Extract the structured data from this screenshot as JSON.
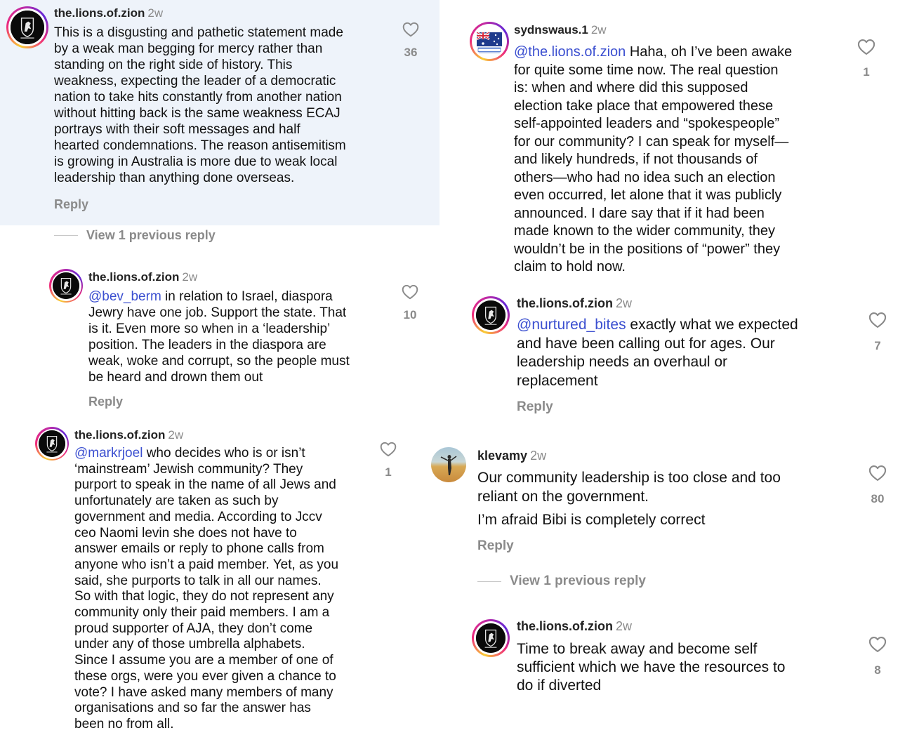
{
  "left": {
    "c1": {
      "username": "the.lions.of.zion",
      "time": "2w",
      "lines": [
        "This is a disgusting and pathetic statement made",
        "by a weak man begging for mercy rather than",
        "standing on the right side of history. This",
        "weakness, expecting the leader of a democratic",
        "nation to take hits constantly from another nation",
        "without hitting back is the same weakness ECAJ",
        "portrays with their soft messages and half",
        "hearted condemnations. The reason antisemitism",
        "is growing in Australia is more due to weak local",
        "leadership than anything done overseas."
      ],
      "reply": "Reply",
      "likes": "36"
    },
    "view_prev": "View 1 previous reply",
    "c2": {
      "username": "the.lions.of.zion",
      "time": "2w",
      "mention": "@bev_berm",
      "first_rest": " in relation to Israel, diaspora",
      "lines": [
        "Jewry have one job. Support the state. That",
        "is it. Even more so when in a ‘leadership’",
        "position. The leaders in the diaspora are",
        "weak, woke and corrupt, so the people must",
        "be heard and drown them out"
      ],
      "reply": "Reply",
      "likes": "10"
    },
    "c3": {
      "username": "the.lions.of.zion",
      "time": "2w",
      "mention": "@markrjoel",
      "first_rest": " who decides who is or isn’t",
      "lines": [
        "‘mainstream’ Jewish community? They",
        "purport to speak in the name of all Jews and",
        "unfortunately are taken as such by",
        "government and media. According to Jccv",
        "ceo Naomi levin she does not have to",
        "answer emails or reply to phone calls from",
        "anyone who isn’t a paid member. Yet, as you",
        "said, she purports to talk in all our names.",
        "So with that logic, they do not represent any",
        "community only their paid members. I am a",
        "proud supporter of AJA, they don’t come",
        "under any of those umbrella alphabets.",
        "Since I assume you are a member of one of",
        "these orgs, were you ever given a chance to",
        "vote? I have asked many members of many",
        "organisations and so far the answer has",
        "been no from all."
      ],
      "likes": "1"
    }
  },
  "right": {
    "c1": {
      "username": "sydnswaus.1",
      "time": "2w",
      "mention": "@the.lions.of.zion",
      "first_rest": " Haha, oh I’ve been awake",
      "lines": [
        "for quite some time now. The real question",
        "is: when and where did this supposed",
        "election take place that empowered these",
        "self-appointed leaders and “spokespeople”",
        "for our community? I can speak for myself—",
        "and likely hundreds, if not thousands of",
        "others—who had no idea such an election",
        "even occurred, let alone that it was publicly",
        "announced. I dare say that if it had been",
        "made known to the wider community, they",
        "wouldn’t be in the positions of “power” they",
        "claim to hold now."
      ],
      "likes": "1"
    },
    "c2": {
      "username": "the.lions.of.zion",
      "time": "2w",
      "mention": "@nurtured_bites",
      "first_rest": " exactly what we expected",
      "lines": [
        "and have been calling out for ages. Our",
        "leadership needs an overhaul or",
        "replacement"
      ],
      "reply": "Reply",
      "likes": "7"
    },
    "c3": {
      "username": "klevamy",
      "time": "2w",
      "lines": [
        "Our community leadership is too close and too",
        "reliant on the government."
      ],
      "line2": "I’m afraid Bibi is completely correct",
      "reply": "Reply",
      "likes": "80"
    },
    "view_prev": "View 1 previous reply",
    "c4": {
      "username": "the.lions.of.zion",
      "time": "2w",
      "lines": [
        "Time to break away and become self",
        "sufficient which we have the resources to",
        "do if diverted"
      ],
      "likes": "8"
    }
  },
  "colors": {
    "highlight": "#eef3fa",
    "mention": "#3b4fd0",
    "muted": "#8a8a8a"
  }
}
